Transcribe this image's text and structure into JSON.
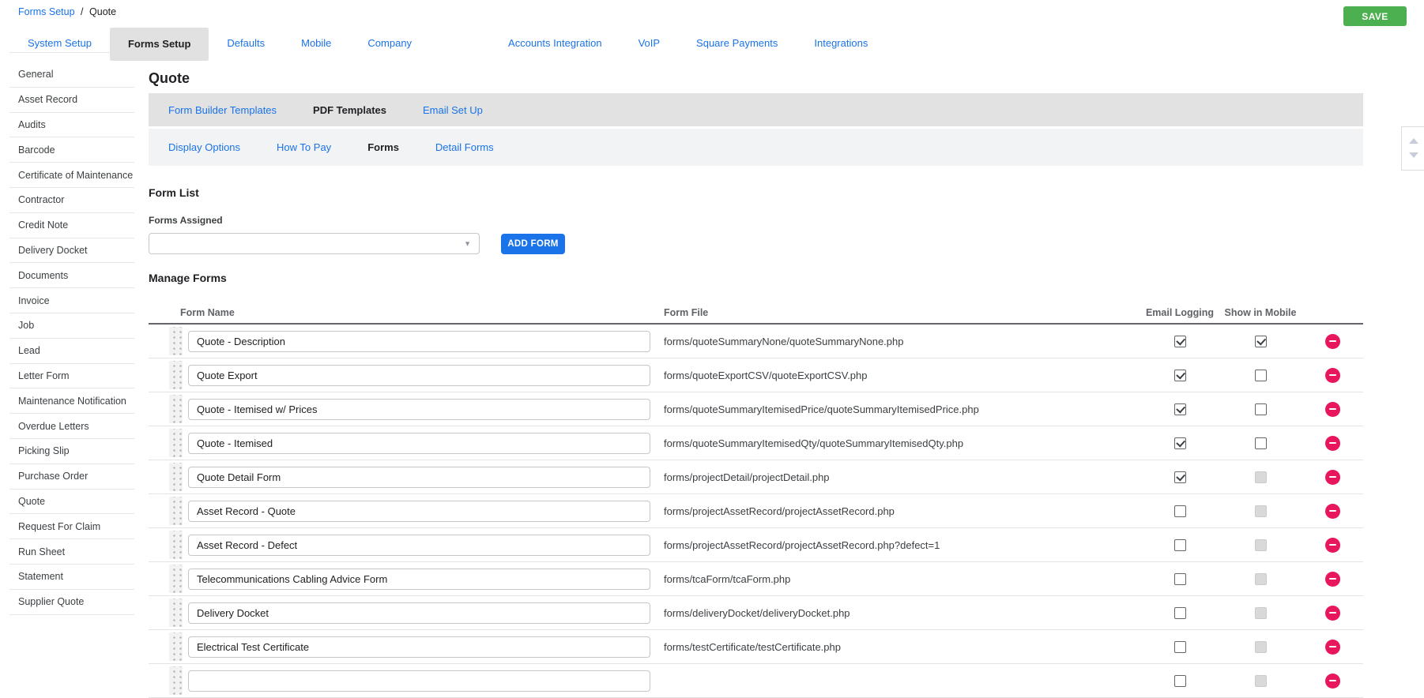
{
  "breadcrumb": {
    "link": "Forms Setup",
    "separator": "/",
    "current": "Quote"
  },
  "save_button": "SAVE",
  "top_tabs": {
    "items": [
      {
        "label": "System Setup",
        "active": false
      },
      {
        "label": "Forms Setup",
        "active": true
      },
      {
        "label": "Defaults",
        "active": false
      },
      {
        "label": "Mobile",
        "active": false
      },
      {
        "label": "Company",
        "active": false
      },
      {
        "label": "Accounts Integration",
        "active": false
      },
      {
        "label": "VoIP",
        "active": false
      },
      {
        "label": "Square Payments",
        "active": false
      },
      {
        "label": "Integrations",
        "active": false
      }
    ]
  },
  "sidebar": {
    "items": [
      "General",
      "Asset Record",
      "Audits",
      "Barcode",
      "Certificate of Maintenance",
      "Contractor",
      "Credit Note",
      "Delivery Docket",
      "Documents",
      "Invoice",
      "Job",
      "Lead",
      "Letter Form",
      "Maintenance Notification",
      "Overdue Letters",
      "Picking Slip",
      "Purchase Order",
      "Quote",
      "Request For Claim",
      "Run Sheet",
      "Statement",
      "Supplier Quote"
    ]
  },
  "main": {
    "title": "Quote",
    "template_tabs": [
      {
        "label": "Form Builder Templates",
        "active": false
      },
      {
        "label": "PDF Templates",
        "active": true
      },
      {
        "label": "Email Set Up",
        "active": false
      }
    ],
    "pdf_sub_tabs": [
      {
        "label": "Display Options",
        "active": false
      },
      {
        "label": "How To Pay",
        "active": false
      },
      {
        "label": "Forms",
        "active": true
      },
      {
        "label": "Detail Forms",
        "active": false
      }
    ],
    "form_list": {
      "heading": "Form List",
      "forms_assigned_label": "Forms Assigned",
      "dropdown_value": "",
      "add_form_button": "ADD FORM"
    },
    "manage_forms": {
      "heading": "Manage Forms",
      "columns": [
        "Form Name",
        "Form File",
        "Email Logging",
        "Show in Mobile"
      ],
      "rows": [
        {
          "name": "Quote - Description",
          "file": "forms/quoteSummaryNone/quoteSummaryNone.php",
          "email_logging": "checked",
          "show_in_mobile": "checked"
        },
        {
          "name": "Quote Export",
          "file": "forms/quoteExportCSV/quoteExportCSV.php",
          "email_logging": "checked",
          "show_in_mobile": "unchecked"
        },
        {
          "name": "Quote - Itemised w/ Prices",
          "file": "forms/quoteSummaryItemisedPrice/quoteSummaryItemisedPrice.php",
          "email_logging": "checked",
          "show_in_mobile": "unchecked"
        },
        {
          "name": "Quote - Itemised",
          "file": "forms/quoteSummaryItemisedQty/quoteSummaryItemisedQty.php",
          "email_logging": "checked",
          "show_in_mobile": "unchecked"
        },
        {
          "name": "Quote Detail Form",
          "file": "forms/projectDetail/projectDetail.php",
          "email_logging": "checked",
          "show_in_mobile": "disabled"
        },
        {
          "name": "Asset Record - Quote",
          "file": "forms/projectAssetRecord/projectAssetRecord.php",
          "email_logging": "unchecked",
          "show_in_mobile": "disabled"
        },
        {
          "name": "Asset Record - Defect",
          "file": "forms/projectAssetRecord/projectAssetRecord.php?defect=1",
          "email_logging": "unchecked",
          "show_in_mobile": "disabled"
        },
        {
          "name": "Telecommunications Cabling Advice Form",
          "file": "forms/tcaForm/tcaForm.php",
          "email_logging": "unchecked",
          "show_in_mobile": "disabled"
        },
        {
          "name": "Delivery Docket",
          "file": "forms/deliveryDocket/deliveryDocket.php",
          "email_logging": "unchecked",
          "show_in_mobile": "disabled"
        },
        {
          "name": "Electrical Test Certificate",
          "file": "forms/testCertificate/testCertificate.php",
          "email_logging": "unchecked",
          "show_in_mobile": "disabled"
        },
        {
          "name": "",
          "file": "",
          "email_logging": "unchecked",
          "show_in_mobile": "disabled"
        }
      ]
    }
  },
  "icons": {
    "dropdown_arrow": "▼",
    "remove_form": "minus-circle",
    "drag_handle": "dot-grid",
    "scroll_up": "triangle-up",
    "scroll_down": "triangle-down"
  },
  "colors": {
    "accent_blue": "#1a73e8",
    "save_green": "#4caf50",
    "delete_red": "#e8175d",
    "active_tab_bg": "#e1e1e1",
    "template_strip_bg": "#e2e2e2",
    "sub_strip_bg": "#f1f3f4"
  }
}
